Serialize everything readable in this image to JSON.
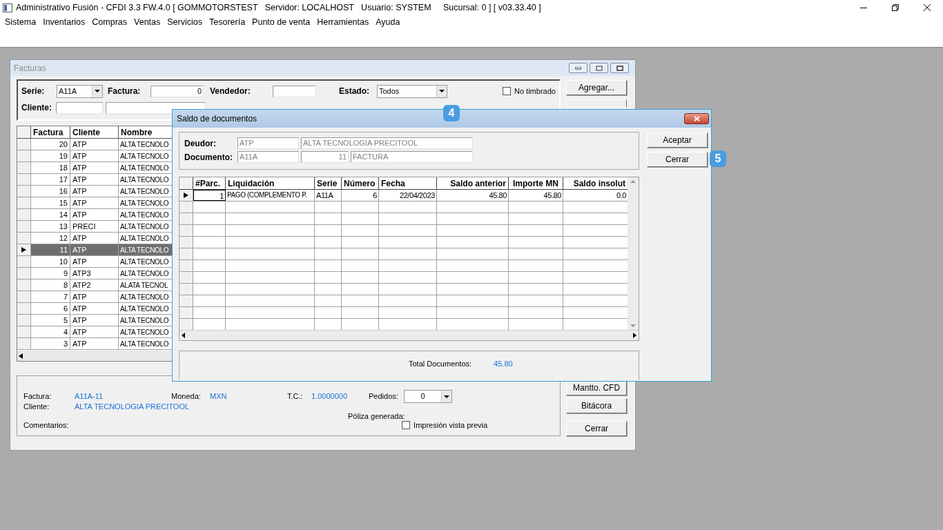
{
  "app_window": {
    "title": "Administrativo Fusión - CFDI 3.3 FW.4.0 [ GOMMOTORSTEST   Servidor: LOCALHOST   Usuario: SYSTEM     Sucursal: 0 ] [ v03.33.40 ]",
    "menu": [
      "Sistema",
      "Inventarios",
      "Compras",
      "Ventas",
      "Servicios",
      "Tesorería",
      "Punto de venta",
      "Herramientas",
      "Ayuda"
    ]
  },
  "facturas_window": {
    "title": "Facturas",
    "filters": {
      "serie_label": "Serie:",
      "serie_value": "A11A",
      "factura_label": "Factura:",
      "factura_value": "0",
      "vendedor_label": "Vendedor:",
      "estado_label": "Estado:",
      "estado_value": "Todos",
      "cliente_label": "Cliente:",
      "checks": [
        {
          "label": "No timbrado",
          "checked": false
        }
      ]
    },
    "table": {
      "columns": [
        "Factura",
        "Cliente",
        "Nombre"
      ],
      "rows": [
        {
          "factura": "20",
          "cliente": "ATP",
          "nombre": "ALTA TECNOLO",
          "selected": false
        },
        {
          "factura": "19",
          "cliente": "ATP",
          "nombre": "ALTA TECNOLO",
          "selected": false
        },
        {
          "factura": "18",
          "cliente": "ATP",
          "nombre": "ALTA TECNOLO",
          "selected": false
        },
        {
          "factura": "17",
          "cliente": "ATP",
          "nombre": "ALTA TECNOLO",
          "selected": false
        },
        {
          "factura": "16",
          "cliente": "ATP",
          "nombre": "ALTA TECNOLO",
          "selected": false
        },
        {
          "factura": "15",
          "cliente": "ATP",
          "nombre": "ALTA TECNOLO",
          "selected": false
        },
        {
          "factura": "14",
          "cliente": "ATP",
          "nombre": "ALTA TECNOLO",
          "selected": false
        },
        {
          "factura": "13",
          "cliente": "PRECI",
          "nombre": "ALTA TECNOLO",
          "selected": false
        },
        {
          "factura": "12",
          "cliente": "ATP",
          "nombre": "ALTA TECNOLO",
          "selected": false
        },
        {
          "factura": "11",
          "cliente": "ATP",
          "nombre": "ALTA TECNOLO",
          "selected": true
        },
        {
          "factura": "10",
          "cliente": "ATP",
          "nombre": "ALTA TECNOLO",
          "selected": false
        },
        {
          "factura": "9",
          "cliente": "ATP3",
          "nombre": "ALTA TECNOLO",
          "selected": false
        },
        {
          "factura": "8",
          "cliente": "ATP2",
          "nombre": "ALATA TECNOL",
          "selected": false
        },
        {
          "factura": "7",
          "cliente": "ATP",
          "nombre": "ALTA TECNOLO",
          "selected": false
        },
        {
          "factura": "6",
          "cliente": "ATP",
          "nombre": "ALTA TECNOLO",
          "selected": false
        },
        {
          "factura": "5",
          "cliente": "ATP",
          "nombre": "ALTA TECNOLO",
          "selected": false
        },
        {
          "factura": "4",
          "cliente": "ATP",
          "nombre": "ALTA TECNOLO",
          "selected": false
        },
        {
          "factura": "3",
          "cliente": "ATP",
          "nombre": "ALTA TECNOLO",
          "selected": false
        }
      ]
    },
    "details": {
      "factura_label": "Factura:",
      "factura_value": "A11A-11",
      "moneda_label": "Moneda:",
      "moneda_value": "MXN",
      "tc_label": "T.C.:",
      "tc_value": "1.0000000",
      "pedidos_label": "Pedidos:",
      "pedidos_value": "0",
      "cliente_label": "Cliente:",
      "cliente_value": "ALTA TECNOLOGIA PRECITOOL",
      "poliza_label": "Póliza generada:",
      "comentarios_label": "Comentarios:",
      "preview": {
        "label": "Impresión vista previa",
        "checked": false
      }
    },
    "top_buttons": [
      "Agregar..."
    ],
    "bottom_buttons": [
      "Mantto. CFD",
      "Bitácora",
      "Cerrar"
    ]
  },
  "saldo_dialog": {
    "title": "Saldo de documentos",
    "deudor_label": "Deudor:",
    "deudor_code": "ATP",
    "deudor_name": "ALTA TECNOLOGIA PRECITOOL",
    "documento_label": "Documento:",
    "documento_serie": "A11A",
    "documento_numero": "11",
    "documento_tipo": "FACTURA",
    "grid": {
      "columns": [
        "#Parc.",
        "Liquidación",
        "Serie",
        "Número",
        "Fecha",
        "Saldo anterior",
        "Importe MN",
        "Saldo insolut"
      ],
      "rows": [
        {
          "cells": [
            "1",
            "PAGO (COMPLEMENTO P.",
            "A11A",
            "6",
            "22/04/2023",
            "45.80",
            "45.80",
            "0.0"
          ],
          "selected": true
        }
      ]
    },
    "total_label": "Total  Documentos:",
    "total_value": "45.80",
    "buttons": [
      "Aceptar",
      "Cerrar"
    ]
  },
  "badges": [
    "4",
    "5"
  ]
}
